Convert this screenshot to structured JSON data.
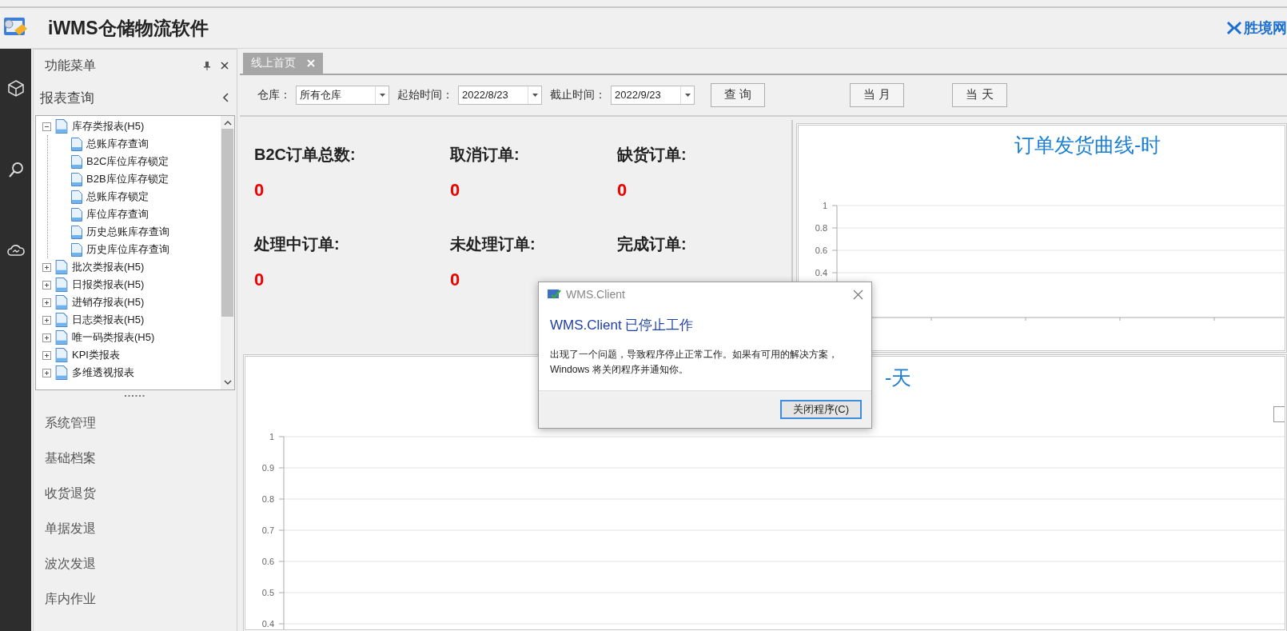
{
  "app": {
    "title": "iWMS仓储物流软件",
    "brand": "胜境网"
  },
  "panel": {
    "title": "功能菜单",
    "section": "报表查询"
  },
  "tree": [
    {
      "label": "库存类报表(H5)",
      "expanded": true,
      "children": [
        {
          "label": "总账库存查询"
        },
        {
          "label": "B2C库位库存锁定"
        },
        {
          "label": "B2B库位库存锁定"
        },
        {
          "label": "总账库存锁定"
        },
        {
          "label": "库位库存查询"
        },
        {
          "label": "历史总账库存查询"
        },
        {
          "label": "历史库位库存查询"
        }
      ]
    },
    {
      "label": "批次类报表(H5)",
      "expanded": false
    },
    {
      "label": "日报类报表(H5)",
      "expanded": false
    },
    {
      "label": "进销存报表(H5)",
      "expanded": false
    },
    {
      "label": "日志类报表(H5)",
      "expanded": false
    },
    {
      "label": "唯一码类报表(H5)",
      "expanded": false
    },
    {
      "label": "KPI类报表",
      "expanded": false
    },
    {
      "label": "多维透视报表",
      "expanded": false
    }
  ],
  "menu": [
    "系统管理",
    "基础档案",
    "收货退货",
    "单据发退",
    "波次发退",
    "库内作业"
  ],
  "tabs": [
    {
      "label": "线上首页",
      "selected": true
    }
  ],
  "filters": [
    {
      "label": "仓库：",
      "value": "所有仓库"
    },
    {
      "label": "起始时间：",
      "value": "2022/8/23"
    },
    {
      "label": "截止时间：",
      "value": "2022/9/23"
    }
  ],
  "buttons": [
    "查 询",
    "当 月",
    "当 天"
  ],
  "stats": [
    {
      "label": "B2C订单总数:",
      "value": "0"
    },
    {
      "label": "取消订单:",
      "value": "0"
    },
    {
      "label": "缺货订单:",
      "value": "0"
    },
    {
      "label": "处理中订单:",
      "value": "0"
    },
    {
      "label": "未处理订单:",
      "value": "0"
    },
    {
      "label": "完成订单:"
    }
  ],
  "charts": [
    {
      "kind": "grid",
      "title": "订单发货曲线-时",
      "y_labels": [
        "1",
        "0.8",
        "0.6",
        "0.4"
      ]
    },
    {
      "kind": "grid",
      "title": "-天",
      "y_labels": [
        "1",
        "0.9",
        "0.8",
        "0.7",
        "0.6",
        "0.5",
        "0.4"
      ]
    }
  ],
  "dialog": {
    "title": "WMS.Client",
    "heading": "WMS.Client 已停止工作",
    "message": "出现了一个问题，导致程序停止正常工作。如果有可用的解决方案，Windows 将关闭程序并通知你。",
    "button": "关闭程序(C)"
  }
}
